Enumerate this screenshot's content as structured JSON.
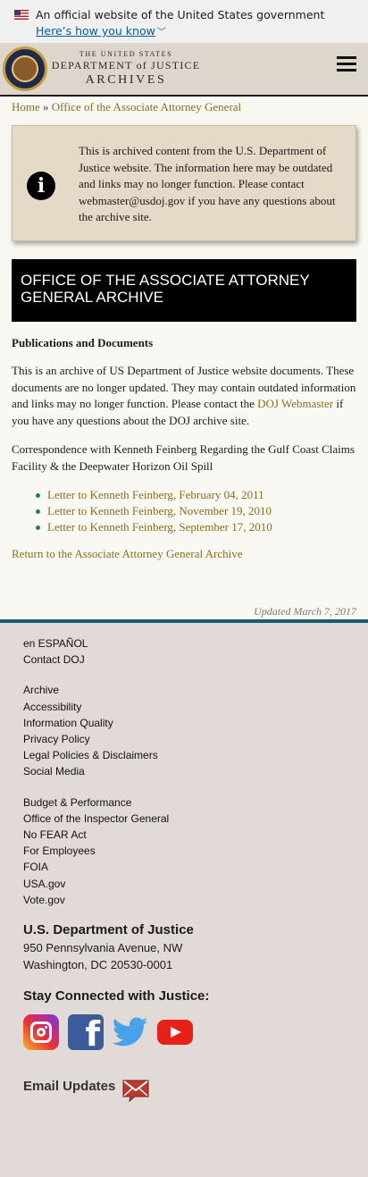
{
  "gov_banner": {
    "text": "An official website of the United States government",
    "link": "Here’s how you know",
    "chevron": "﹀"
  },
  "header": {
    "line1": "THE UNITED STATES",
    "line2": "DEPARTMENT of JUSTICE",
    "line3": "ARCHIVES"
  },
  "breadcrumb": {
    "home": "Home",
    "sep": " » ",
    "current": "Office of the Associate Attorney General"
  },
  "notice": {
    "icon": "i",
    "text": "This is archived content from the U.S. Department of Justice website. The information here may be outdated and links may no longer function. Please contact webmaster@usdoj.gov if you have any questions about the archive site."
  },
  "page_title": "OFFICE OF THE ASSOCIATE ATTORNEY GENERAL ARCHIVE",
  "content": {
    "section_title": "Publications and Documents",
    "intro_before": "This is an archive of US Department of Justice website documents. These documents are no longer updated. They may contain outdated information and links may no longer function. Please contact the ",
    "intro_link": "DOJ Webmaster",
    "intro_after": " if you have any questions about the DOJ archive site.",
    "correspondence": "Correspondence with Kenneth Feinberg Regarding the Gulf Coast Claims Facility & the Deepwater Horizon Oil Spill",
    "letters": [
      "Letter to Kenneth Feinberg, February 04, 2011",
      "Letter to Kenneth Feinberg, November 19, 2010",
      "Letter to Kenneth Feinberg, September 17, 2010"
    ],
    "return_link": "Return to the Associate Attorney General Archive",
    "updated": "Updated March 7, 2017"
  },
  "footer": {
    "group1": [
      "en ESPAÑOL",
      "Contact DOJ"
    ],
    "group2": [
      "Archive",
      "Accessibility",
      "Information Quality",
      "Privacy Policy",
      "Legal Policies & Disclaimers",
      "Social Media"
    ],
    "group3": [
      "Budget & Performance",
      "Office of the Inspector General",
      "No FEAR Act",
      "For Employees",
      "FOIA",
      "USA.gov",
      "Vote.gov"
    ],
    "org_name": "U.S. Department of Justice",
    "address_line1": "950 Pennsylvania Avenue, NW",
    "address_line2": "Washington, DC 20530-0001",
    "stay_connected": "Stay Connected with Justice:",
    "socials": [
      "instagram-icon",
      "facebook-icon",
      "twitter-icon",
      "youtube-icon"
    ],
    "facebook_glyph": "f",
    "email_updates": "Email Updates"
  },
  "colors": {
    "link": "#8a6d1e",
    "header_bg": "#dcd6cd",
    "notice_bg": "#e5d9c7",
    "footer_bg": "#e2dad6",
    "divider": "#1a5b72"
  }
}
